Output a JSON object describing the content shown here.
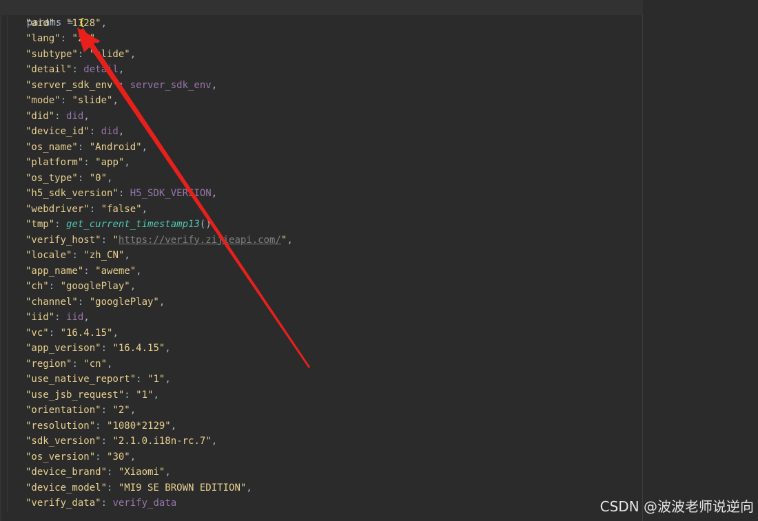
{
  "code": {
    "header": {
      "name": "params",
      "op": " = ",
      "brace": "{"
    },
    "lines": [
      {
        "key": "\"aid\"",
        "sep": ": ",
        "value": "\"1128\"",
        "vtype": "str",
        "tail": ","
      },
      {
        "key": "\"lang\"",
        "sep": ": ",
        "value": "\"zh\"",
        "vtype": "str",
        "tail": ","
      },
      {
        "key": "\"subtype\"",
        "sep": ": ",
        "value": "\"slide\"",
        "vtype": "str",
        "tail": ","
      },
      {
        "key": "\"detail\"",
        "sep": ": ",
        "value": "detail",
        "vtype": "var",
        "tail": ","
      },
      {
        "key": "\"server_sdk_env\"",
        "sep": ": ",
        "value": "server_sdk_env",
        "vtype": "var",
        "tail": ","
      },
      {
        "key": "\"mode\"",
        "sep": ": ",
        "value": "\"slide\"",
        "vtype": "str",
        "tail": ","
      },
      {
        "key": "\"did\"",
        "sep": ": ",
        "value": "did",
        "vtype": "var",
        "tail": ","
      },
      {
        "key": "\"device_id\"",
        "sep": ": ",
        "value": "did",
        "vtype": "var",
        "tail": ","
      },
      {
        "key": "\"os_name\"",
        "sep": ": ",
        "value": "\"Android\"",
        "vtype": "str",
        "tail": ","
      },
      {
        "key": "\"platform\"",
        "sep": ": ",
        "value": "\"app\"",
        "vtype": "str",
        "tail": ","
      },
      {
        "key": "\"os_type\"",
        "sep": ": ",
        "value": "\"0\"",
        "vtype": "str",
        "tail": ","
      },
      {
        "key": "\"h5_sdk_version\"",
        "sep": ": ",
        "value": "H5_SDK_VERSION",
        "vtype": "var",
        "tail": ","
      },
      {
        "key": "\"webdriver\"",
        "sep": ": ",
        "value": "\"false\"",
        "vtype": "str",
        "tail": ","
      },
      {
        "key": "\"tmp\"",
        "sep": ": ",
        "value": "get_current_timestamp13",
        "vtype": "fn",
        "tail": "(),"
      },
      {
        "key": "\"verify_host\"",
        "sep": ": ",
        "value": "https://verify.zijieapi.com/",
        "vtype": "url",
        "tail": ","
      },
      {
        "key": "\"locale\"",
        "sep": ": ",
        "value": "\"zh_CN\"",
        "vtype": "str",
        "tail": ","
      },
      {
        "key": "\"app_name\"",
        "sep": ": ",
        "value": "\"aweme\"",
        "vtype": "str",
        "tail": ","
      },
      {
        "key": "\"ch\"",
        "sep": ": ",
        "value": "\"googlePlay\"",
        "vtype": "str",
        "tail": ","
      },
      {
        "key": "\"channel\"",
        "sep": ": ",
        "value": "\"googlePlay\"",
        "vtype": "str",
        "tail": ","
      },
      {
        "key": "\"iid\"",
        "sep": ": ",
        "value": "iid",
        "vtype": "var",
        "tail": ","
      },
      {
        "key": "\"vc\"",
        "sep": ": ",
        "value": "\"16.4.15\"",
        "vtype": "str",
        "tail": ","
      },
      {
        "key": "\"app_verison\"",
        "sep": ": ",
        "value": "\"16.4.15\"",
        "vtype": "str",
        "tail": ","
      },
      {
        "key": "\"region\"",
        "sep": ": ",
        "value": "\"cn\"",
        "vtype": "str",
        "tail": ","
      },
      {
        "key": "\"use_native_report\"",
        "sep": ": ",
        "value": "\"1\"",
        "vtype": "str",
        "tail": ","
      },
      {
        "key": "\"use_jsb_request\"",
        "sep": ": ",
        "value": "\"1\"",
        "vtype": "str",
        "tail": ","
      },
      {
        "key": "\"orientation\"",
        "sep": ": ",
        "value": "\"2\"",
        "vtype": "str",
        "tail": ","
      },
      {
        "key": "\"resolution\"",
        "sep": ": ",
        "value": "\"1080*2129\"",
        "vtype": "str",
        "tail": ","
      },
      {
        "key": "\"sdk_version\"",
        "sep": ": ",
        "value": "\"2.1.0.i18n-rc.7\"",
        "vtype": "str",
        "tail": ","
      },
      {
        "key": "\"os_version\"",
        "sep": ": ",
        "value": "\"30\"",
        "vtype": "str",
        "tail": ","
      },
      {
        "key": "\"device_brand\"",
        "sep": ": ",
        "value": "\"Xiaomi\"",
        "vtype": "str",
        "tail": ","
      },
      {
        "key": "\"device_model\"",
        "sep": ": ",
        "value": "\"MI9 SE BROWN EDITION\"",
        "vtype": "str",
        "tail": ","
      },
      {
        "key": "\"verify_data\"",
        "sep": ": ",
        "value": "verify_data",
        "vtype": "var",
        "tail": ""
      }
    ]
  },
  "watermark": "CSDN @波波老师说逆向",
  "colors": {
    "background": "#2b2b2b",
    "string": "#e8d08f",
    "variable": "#9876aa",
    "function": "#4ec9b0",
    "url": "#808080",
    "annotation_arrow": "#e8201c"
  },
  "annotation": {
    "type": "arrow",
    "color": "#e8201c"
  }
}
